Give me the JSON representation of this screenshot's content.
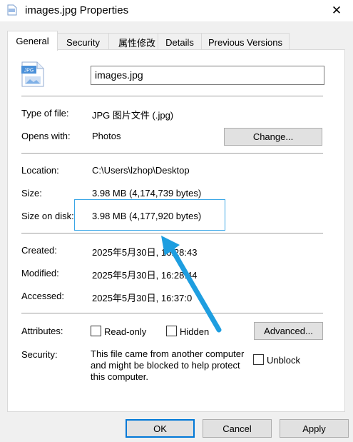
{
  "window": {
    "title": "images.jpg Properties",
    "close_glyph": "✕"
  },
  "tabs": [
    {
      "label": "General",
      "active": true
    },
    {
      "label": "Security",
      "active": false
    },
    {
      "label": "属性修改",
      "active": false
    },
    {
      "label": "Details",
      "active": false
    },
    {
      "label": "Previous Versions",
      "active": false
    }
  ],
  "file": {
    "icon_label": "JPG",
    "name": "images.jpg"
  },
  "info": {
    "type_label": "Type of file:",
    "type_value": "JPG 图片文件 (.jpg)",
    "opens_label": "Opens with:",
    "opens_value": "Photos",
    "change_button": "Change...",
    "location_label": "Location:",
    "location_value": "C:\\Users\\lzhop\\Desktop",
    "size_label": "Size:",
    "size_value": "3.98 MB (4,174,739 bytes)",
    "size_on_disk_label": "Size on disk:",
    "size_on_disk_value": "3.98 MB (4,177,920 bytes)",
    "created_label": "Created:",
    "created_value": "2025年5月30日, 16:28:43",
    "modified_label": "Modified:",
    "modified_value": "2025年5月30日, 16:28:44",
    "accessed_label": "Accessed:",
    "accessed_value": "2025年5月30日, 16:37:0"
  },
  "attributes": {
    "label": "Attributes:",
    "read_only": "Read-only",
    "hidden": "Hidden",
    "advanced_button": "Advanced..."
  },
  "security": {
    "label": "Security:",
    "text": "This file came from another computer and might be blocked to help protect this computer.",
    "unblock": "Unblock"
  },
  "buttons": {
    "ok": "OK",
    "cancel": "Cancel",
    "apply": "Apply"
  },
  "colors": {
    "highlight_box": "#3aa6e6",
    "annotation_arrow": "#1e9ee0",
    "ok_border": "#0078d7"
  }
}
